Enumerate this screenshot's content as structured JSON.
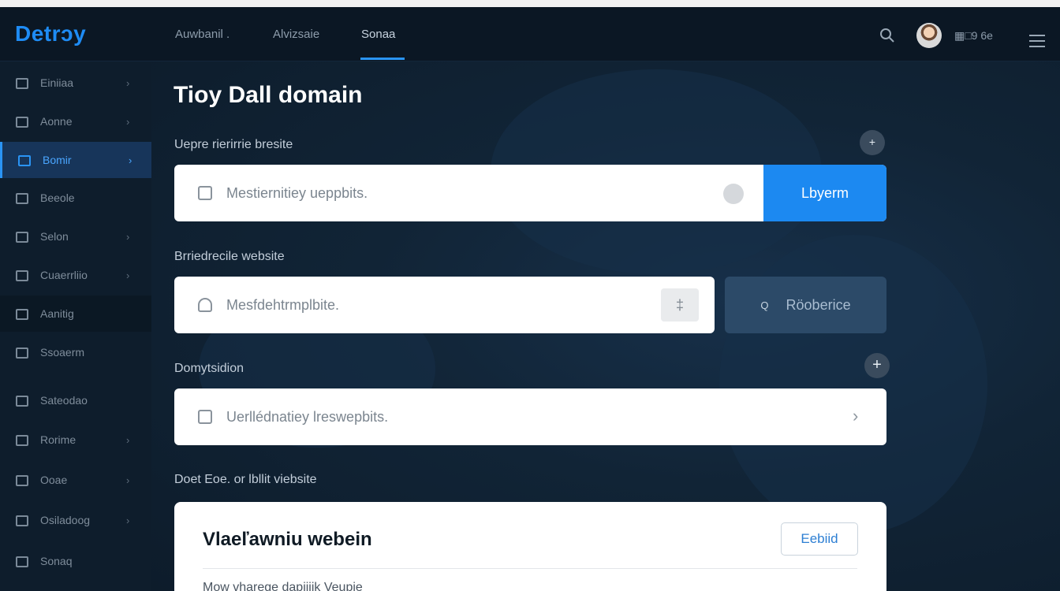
{
  "app": {
    "brand": "Detrɔy",
    "nav": [
      {
        "label": "Auwbanil ."
      },
      {
        "label": "Alvizsaie"
      },
      {
        "label": "Sonaa"
      }
    ],
    "user": {
      "name": "▦□9 6e"
    }
  },
  "sidebar": {
    "items": [
      {
        "label": "Einiiaa",
        "icon": "home-icon"
      },
      {
        "label": "Aonne",
        "icon": "grid-icon"
      },
      {
        "label": "Bomir",
        "icon": "lock-icon"
      },
      {
        "label": "Beeole",
        "icon": "calendar-icon"
      },
      {
        "label": "Selon",
        "icon": "apps-icon"
      },
      {
        "label": "Cuaerrliio",
        "icon": "car-icon"
      },
      {
        "label": "Aanitig",
        "icon": "building-icon"
      },
      {
        "label": "Ssoaerm",
        "icon": "pen-icon"
      },
      {
        "label": "Sateodao",
        "icon": "bars-icon"
      },
      {
        "label": "Rorime",
        "icon": "chart-icon"
      },
      {
        "label": "Ooae",
        "icon": "table-icon"
      },
      {
        "label": "Osiladoog",
        "icon": "printer-icon"
      },
      {
        "label": "Sonaq",
        "icon": "box-icon"
      }
    ]
  },
  "main": {
    "title": "Tioy Dall domain",
    "section1": {
      "label": "Uepre rierirrie bresite",
      "placeholder": "Mestiernitiey ueppbits.",
      "button": "Lbyerm",
      "add": "+"
    },
    "section2": {
      "label": "Brriedrecile website",
      "placeholder": "Mesfdehtrmplbite.",
      "mini_button": "‡",
      "button_icon": "Q",
      "button": "Röoberice"
    },
    "section3": {
      "label": "Domytsidion",
      "placeholder": "Uerllédnatiey lreswepbits.",
      "add": "+",
      "chevron": "›"
    },
    "section4": {
      "label": "Doet Eoe. or lbllit viebsite",
      "card_title": "Vlaeľawniu webein",
      "card_button": "Eebiid",
      "card_sub": "Mow vharege dapiiiik Veupie"
    }
  },
  "colors": {
    "accent": "#1c89f1",
    "background": "#0f1f2f",
    "sidebar": "#0e1d2c",
    "sidebar_active": "#17355a"
  }
}
